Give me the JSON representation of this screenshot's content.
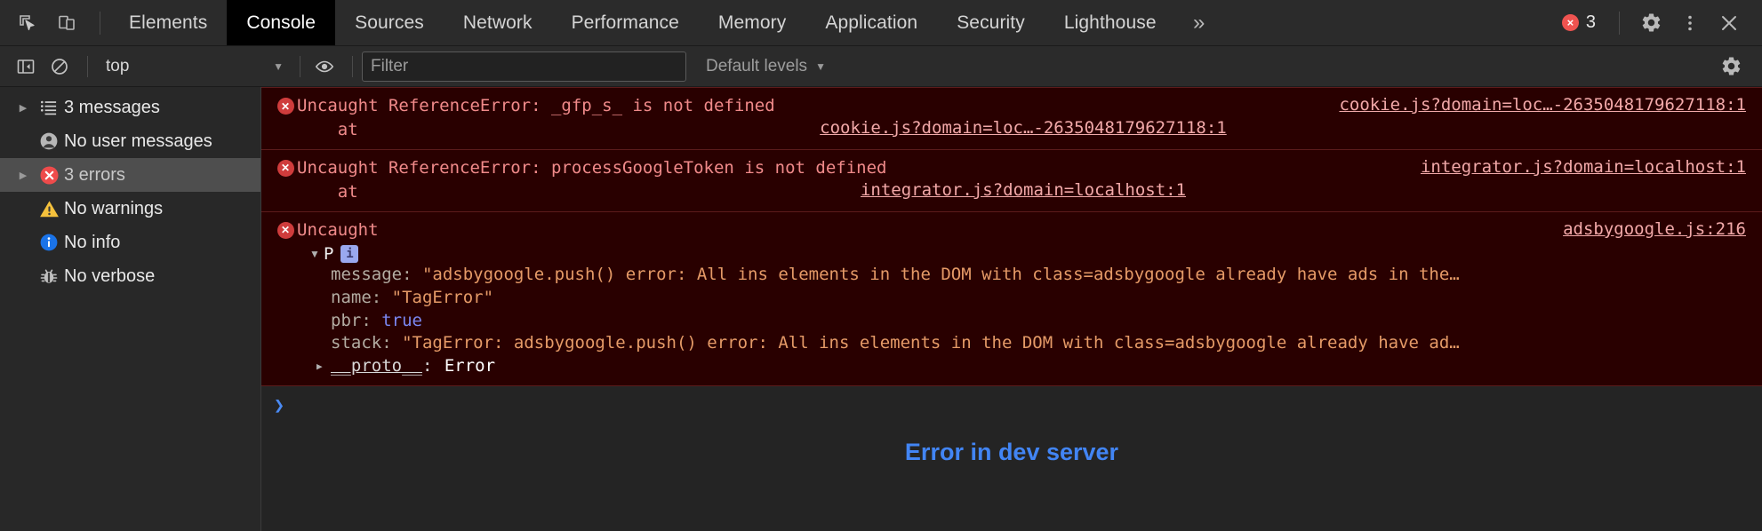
{
  "tabbar": {
    "inspect_icon": "inspect-cursor-icon",
    "device_icon": "device-toolbar-icon",
    "tabs": [
      {
        "label": "Elements",
        "active": false
      },
      {
        "label": "Console",
        "active": true
      },
      {
        "label": "Sources",
        "active": false
      },
      {
        "label": "Network",
        "active": false
      },
      {
        "label": "Performance",
        "active": false
      },
      {
        "label": "Memory",
        "active": false
      },
      {
        "label": "Application",
        "active": false
      },
      {
        "label": "Security",
        "active": false
      },
      {
        "label": "Lighthouse",
        "active": false
      }
    ],
    "more_tabs": "»",
    "error_count": "3",
    "error_badge_glyph": "×",
    "error_badge_color": "#ef5350",
    "settings_icon": "gear-icon",
    "more_options_icon": "kebab-menu-icon",
    "close_icon": "close-icon"
  },
  "filterbar": {
    "sidebar_toggle_icon": "show-console-sidebar-icon",
    "clear_icon": "clear-console-icon",
    "context": "top",
    "context_caret": "▼",
    "eye_icon": "live-expression-icon",
    "filter_value": "",
    "filter_placeholder": "Filter",
    "levels_label": "Default levels",
    "levels_caret": "▼",
    "settings_icon": "console-settings-icon"
  },
  "sidebar": {
    "items": [
      {
        "label": "3 messages",
        "icon": "list-icon",
        "expandable": true,
        "selected": false
      },
      {
        "label": "No user messages",
        "icon": "user-icon",
        "expandable": false,
        "selected": false
      },
      {
        "label": "3 errors",
        "icon": "error-icon",
        "expandable": true,
        "selected": true
      },
      {
        "label": "No warnings",
        "icon": "warning-icon",
        "expandable": false,
        "selected": false
      },
      {
        "label": "No info",
        "icon": "info-icon",
        "expandable": false,
        "selected": false
      },
      {
        "label": "No verbose",
        "icon": "bug-icon",
        "expandable": false,
        "selected": false
      }
    ]
  },
  "console": {
    "messages": [
      {
        "text": "Uncaught ReferenceError: _gfp_s_ is not defined",
        "stack_prefix": "    at ",
        "stack_link": "cookie.js?domain=loc…-2635048179627118:1",
        "source_link": "cookie.js?domain=loc…-2635048179627118:1"
      },
      {
        "text": "Uncaught ReferenceError: processGoogleToken is not defined",
        "stack_prefix": "    at ",
        "stack_link": "integrator.js?domain=localhost:1",
        "source_link": "integrator.js?domain=localhost:1"
      }
    ],
    "object_message": {
      "text": "Uncaught",
      "source_link": "adsbygoogle.js:216",
      "twisty": "▼",
      "constructor": "P",
      "chip": "i",
      "properties": [
        {
          "key": "message",
          "value": "\"adsbygoogle.push() error: All ins elements in the DOM with class=adsbygoogle already have ads in the…",
          "type": "string"
        },
        {
          "key": "name",
          "value": "\"TagError\"",
          "type": "string"
        },
        {
          "key": "pbr",
          "value": "true",
          "type": "boolean"
        },
        {
          "key": "stack",
          "value": "\"TagError: adsbygoogle.push() error: All ins elements in the DOM with class=adsbygoogle already have ad…",
          "type": "string"
        }
      ],
      "proto_twisty": "▶",
      "proto_key": "__proto__",
      "proto_value": "Error"
    },
    "prompt_caret": "❯",
    "dev_banner": "Error in dev server"
  }
}
